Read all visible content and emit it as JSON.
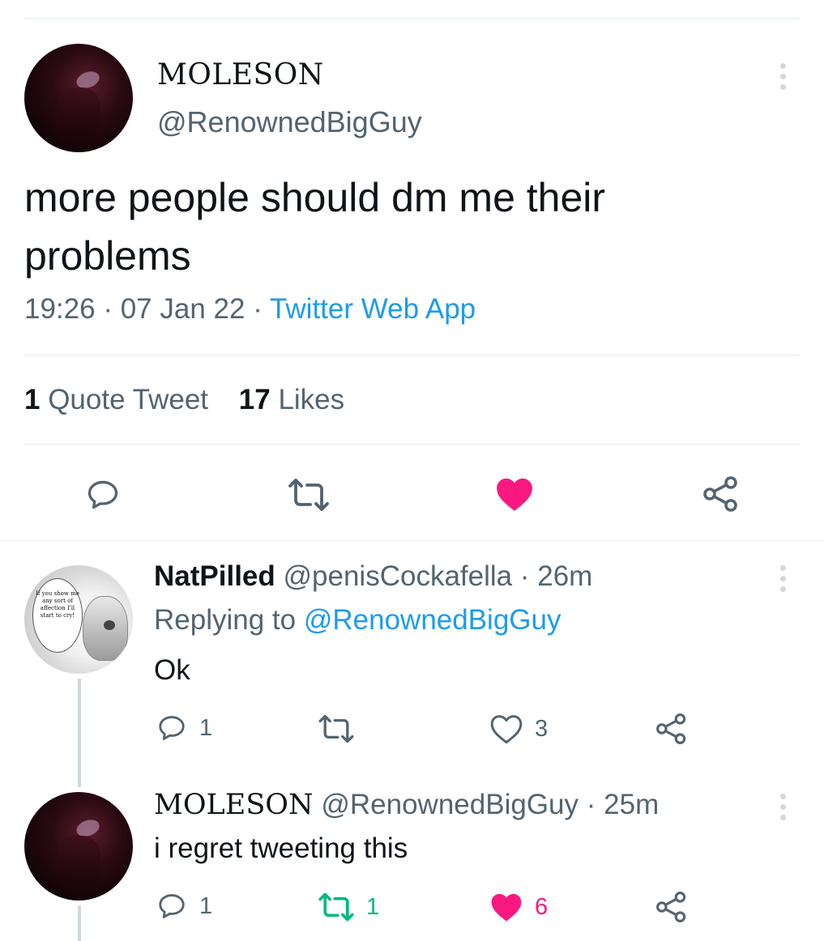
{
  "tweet": {
    "display_name": "MOLESON",
    "handle": "@RenownedBigGuy",
    "text": "more people should dm me their problems",
    "time": "19:26",
    "date": "07 Jan 22",
    "source": "Twitter Web App",
    "quote_count": "1",
    "quote_label": "Quote Tweet",
    "likes_count": "17",
    "likes_label": "Likes",
    "liked": true
  },
  "replies": [
    {
      "display_name": "NatPilled",
      "handle": "@penisCockafella",
      "age": "26m",
      "replying_label": "Replying to",
      "replying_to": "@RenownedBigGuy",
      "text": "Ok",
      "reply_count": "1",
      "retweet_count": "",
      "like_count": "3",
      "avatar_bubble_text": "If you show me any sort of affection I'll start to cry!"
    },
    {
      "display_name": "MOLESON",
      "handle": "@RenownedBigGuy",
      "age": "25m",
      "text": "i regret tweeting this",
      "reply_count": "1",
      "retweet_count": "1",
      "like_count": "6",
      "retweeted": true,
      "liked": true
    }
  ],
  "colors": {
    "like_active": "#f91880",
    "retweet_active": "#00ba7c",
    "link": "#1d9bf0",
    "secondary_text": "#536471",
    "icon": "#536471"
  },
  "icons": {
    "more": "more-vertical-icon",
    "reply": "reply-icon",
    "retweet": "retweet-icon",
    "like": "heart-icon",
    "share": "share-icon"
  }
}
